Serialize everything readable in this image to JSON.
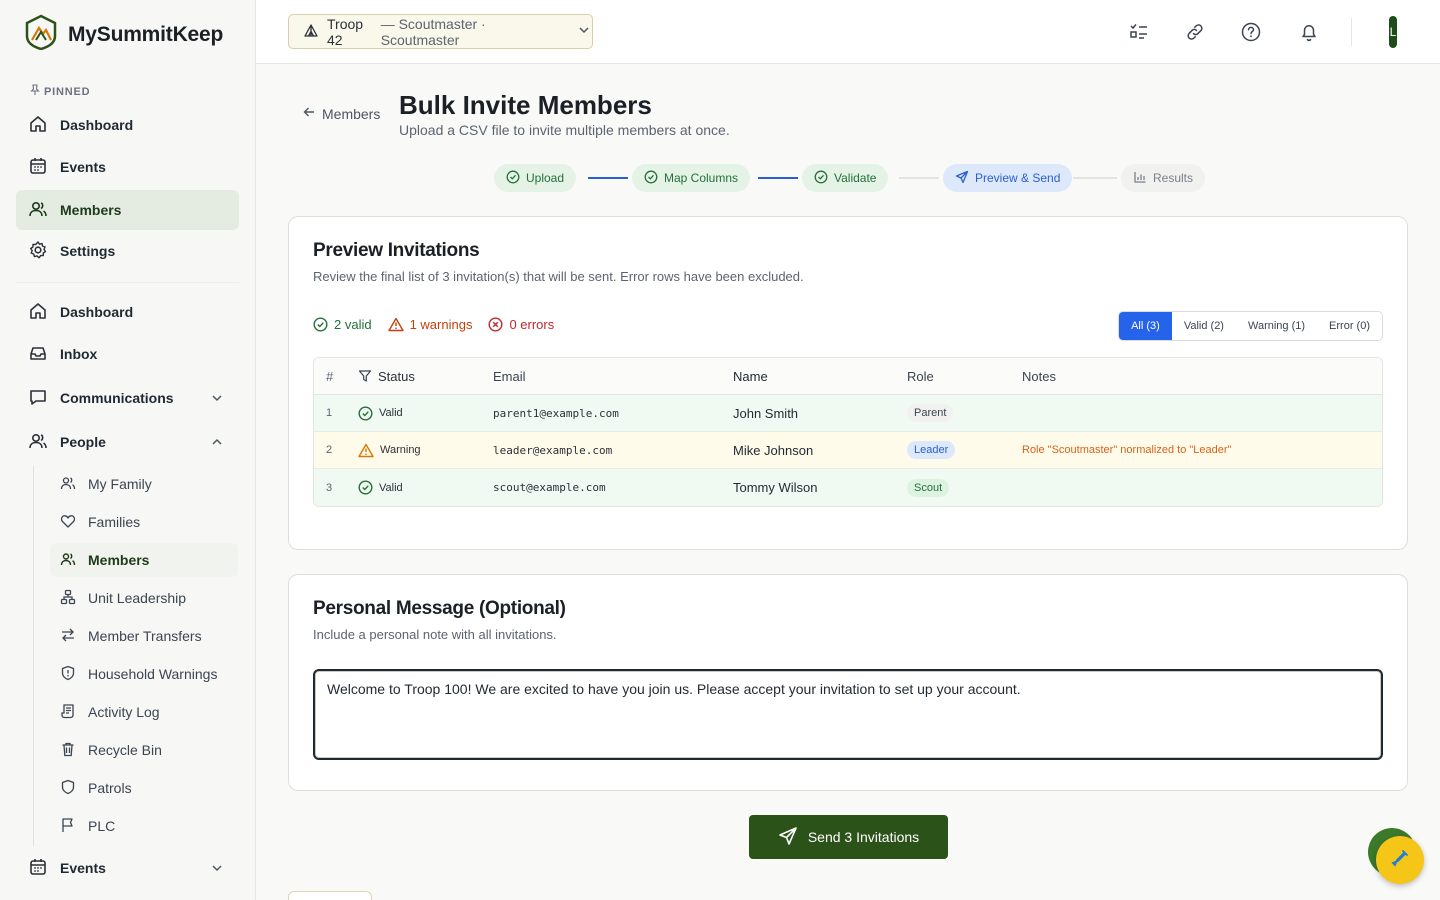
{
  "app": {
    "name": "MySummitKeep"
  },
  "sidebar": {
    "pinned_label": "PINNED",
    "pinned_items": [
      {
        "label": "Dashboard",
        "icon": "home-icon"
      },
      {
        "label": "Events",
        "icon": "calendar-icon"
      },
      {
        "label": "Members",
        "icon": "users-icon",
        "active": true
      },
      {
        "label": "Settings",
        "icon": "gear-icon"
      }
    ],
    "items": [
      {
        "label": "Dashboard",
        "icon": "home-icon"
      },
      {
        "label": "Inbox",
        "icon": "inbox-icon"
      },
      {
        "label": "Communications",
        "icon": "message-icon",
        "expandable": true
      },
      {
        "label": "People",
        "icon": "users-icon",
        "expanded": true
      },
      {
        "label": "Events",
        "icon": "calendar-icon",
        "expandable": true
      }
    ],
    "people_sub_items": [
      {
        "label": "My Family",
        "icon": "users-icon"
      },
      {
        "label": "Families",
        "icon": "heart-icon"
      },
      {
        "label": "Members",
        "icon": "users-icon",
        "active": true
      },
      {
        "label": "Unit Leadership",
        "icon": "org-chart-icon"
      },
      {
        "label": "Member Transfers",
        "icon": "transfer-icon"
      },
      {
        "label": "Household Warnings",
        "icon": "shield-alert-icon"
      },
      {
        "label": "Activity Log",
        "icon": "log-icon"
      },
      {
        "label": "Recycle Bin",
        "icon": "trash-icon"
      },
      {
        "label": "Patrols",
        "icon": "shield-icon"
      },
      {
        "label": "PLC",
        "icon": "flag-icon"
      }
    ]
  },
  "topbar": {
    "troop": "Troop 42",
    "troop_role": " — Scoutmaster · Scoutmaster",
    "icons": [
      "checklist-icon",
      "link-icon",
      "help-icon",
      "bell-icon"
    ],
    "avatar_initial": "L"
  },
  "page": {
    "back_label": "Members",
    "title": "Bulk Invite Members",
    "subtitle": "Upload a CSV file to invite multiple members at once."
  },
  "steps": [
    {
      "label": "Upload",
      "state": "done"
    },
    {
      "label": "Map Columns",
      "state": "done"
    },
    {
      "label": "Validate",
      "state": "done"
    },
    {
      "label": "Preview & Send",
      "state": "current"
    },
    {
      "label": "Results",
      "state": "todo"
    }
  ],
  "preview": {
    "title": "Preview Invitations",
    "subtitle": "Review the final list of 3 invitation(s) that will be sent. Error rows have been excluded.",
    "summary": {
      "valid": "2 valid",
      "warnings": "1 warnings",
      "errors": "0 errors"
    },
    "filters": [
      "All (3)",
      "Valid (2)",
      "Warning (1)",
      "Error (0)"
    ],
    "active_filter": "All (3)",
    "columns": [
      "#",
      "Status",
      "Email",
      "Name",
      "Role",
      "Notes"
    ],
    "rows": [
      {
        "num": "1",
        "status": "Valid",
        "email": "parent1@example.com",
        "name": "John Smith",
        "role": "Parent",
        "notes": ""
      },
      {
        "num": "2",
        "status": "Warning",
        "email": "leader@example.com",
        "name": "Mike Johnson",
        "role": "Leader",
        "notes": "Role \"Scoutmaster\" normalized to \"Leader\""
      },
      {
        "num": "3",
        "status": "Valid",
        "email": "scout@example.com",
        "name": "Tommy Wilson",
        "role": "Scout",
        "notes": ""
      }
    ]
  },
  "message": {
    "title": "Personal Message (Optional)",
    "subtitle": "Include a personal note with all invitations.",
    "value": "Welcome to Troop 100! We are excited to have you join us. Please accept your invitation to set up your account."
  },
  "send_button": "Send 3 Invitations",
  "colors": {
    "brand_green": "#2b5219",
    "valid": "#24703a",
    "warning": "#c2410c",
    "error": "#c0262d",
    "accent_blue": "#2563eb"
  }
}
